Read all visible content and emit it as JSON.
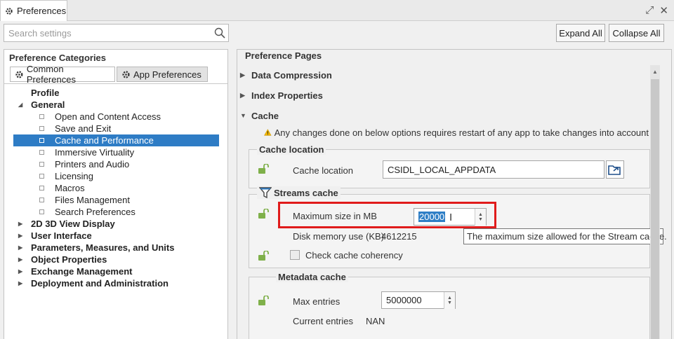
{
  "window": {
    "title": "Preferences"
  },
  "search": {
    "placeholder": "Search settings"
  },
  "toolbar": {
    "expand_all": "Expand All",
    "collapse_all": "Collapse All"
  },
  "left": {
    "heading": "Preference Categories",
    "tabs": [
      {
        "label": "Common Preferences",
        "icon": "gear-icon",
        "active": true
      },
      {
        "label": "App Preferences",
        "icon": "gear-icon",
        "active": false
      }
    ],
    "tree": [
      {
        "label": "Profile",
        "level": 0,
        "bold": true,
        "expander": "none"
      },
      {
        "label": "General",
        "level": 0,
        "bold": true,
        "expander": "expanded"
      },
      {
        "label": "Open and Content Access",
        "level": 1
      },
      {
        "label": "Save and Exit",
        "level": 1
      },
      {
        "label": "Cache and Performance",
        "level": 1,
        "selected": true
      },
      {
        "label": "Immersive Virtuality",
        "level": 1
      },
      {
        "label": "Printers and Audio",
        "level": 1
      },
      {
        "label": "Licensing",
        "level": 1
      },
      {
        "label": "Macros",
        "level": 1
      },
      {
        "label": "Files Management",
        "level": 1
      },
      {
        "label": "Search Preferences",
        "level": 1
      },
      {
        "label": "2D 3D View Display",
        "level": 0,
        "bold": true,
        "expander": "collapsed"
      },
      {
        "label": "User Interface",
        "level": 0,
        "bold": true,
        "expander": "collapsed"
      },
      {
        "label": "Parameters, Measures, and Units",
        "level": 0,
        "bold": true,
        "expander": "collapsed"
      },
      {
        "label": "Object Properties",
        "level": 0,
        "bold": true,
        "expander": "collapsed"
      },
      {
        "label": "Exchange Management",
        "level": 0,
        "bold": true,
        "expander": "collapsed"
      },
      {
        "label": "Deployment and Administration",
        "level": 0,
        "bold": true,
        "expander": "collapsed"
      }
    ]
  },
  "right": {
    "heading": "Preference Pages",
    "sections": {
      "data_compression": "Data Compression",
      "index_properties": "Index Properties",
      "cache": "Cache"
    },
    "warning": "Any changes done on below options requires restart of any app to take changes into account",
    "cache_location": {
      "legend": "Cache location",
      "label": "Cache location",
      "value": "CSIDL_LOCAL_APPDATA"
    },
    "streams_cache": {
      "legend": "Streams cache",
      "max_size_label": "Maximum size in MB",
      "max_size_value": "20000",
      "disk_use_label": "Disk memory use (KB)",
      "disk_use_value": "4612215",
      "tooltip": "The maximum size allowed for the Stream cache.",
      "coherency_label": "Check cache coherency",
      "coherency_checked": false
    },
    "metadata_cache": {
      "legend": "Metadata cache",
      "max_entries_label": "Max entries",
      "max_entries_value": "5000000",
      "current_entries_label": "Current entries",
      "current_entries_value": "NAN"
    }
  },
  "colors": {
    "selection": "#2e7cc5",
    "highlight_box": "#e01b1b",
    "warning": "#f2b600"
  }
}
